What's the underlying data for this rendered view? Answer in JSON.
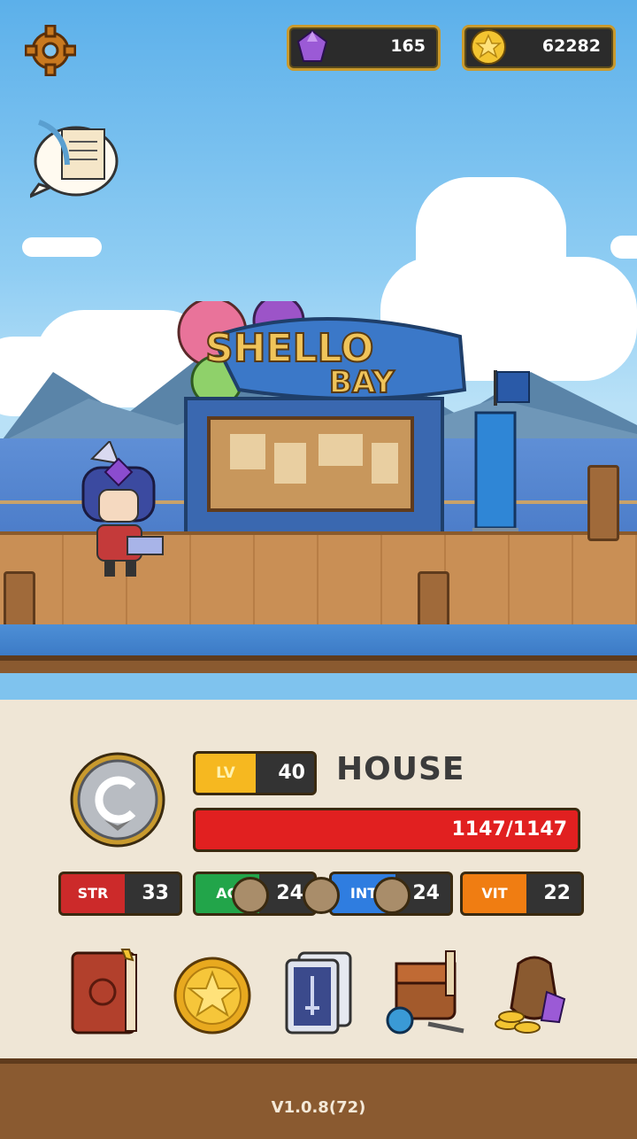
{
  "hud": {
    "gems": "165",
    "gold": "62282"
  },
  "scene": {
    "sign_line1": "SHELLO",
    "sign_line2": "BAY"
  },
  "character": {
    "level_label": "LV",
    "level": "40",
    "name": "HOUSE",
    "hp": "1147/1147",
    "stats": [
      {
        "label": "STR",
        "value": "33",
        "color": "#cc2a2a"
      },
      {
        "label": "AG",
        "value": "24",
        "color": "#22a54a"
      },
      {
        "label": "INT",
        "value": "24",
        "color": "#2f7de0"
      },
      {
        "label": "VIT",
        "value": "22",
        "color": "#f07d12"
      }
    ]
  },
  "menu": [
    "book-icon",
    "gold-coin-icon",
    "cards-icon",
    "bag-icon",
    "treasure-sack-icon"
  ],
  "version": "V1.0.8(72)"
}
